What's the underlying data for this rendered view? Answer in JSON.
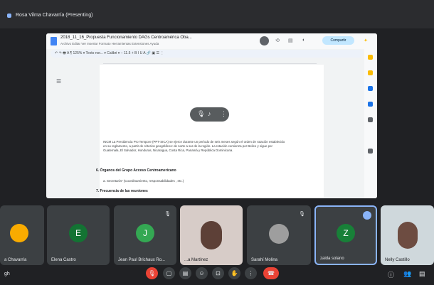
{
  "presenter": {
    "label": "Rosa Vilma Chavarría (Presenting)"
  },
  "doc": {
    "title": "2018_11_16_Propuesta Funcionamiento DAGs Centroamérica Oba...",
    "menu": "Archivo  Editar  Ver  Insertar  Formato  Herramientas  Extensiones  Ayuda",
    "share_label": "Compartir",
    "toolbar_text": "↶  ↷  🖶  A  ¶   125%  ▾   Texto nor... ▾   Calibri  ▾   −  11.5  +   B  I  U  A   🔗  ▣  ☰  ⋮",
    "paragraph": "INCM La Presidencia Pro Tempore (PPT-SICA) se ejerce durante un período de seis meses según el orden de rotación establecido en su reglamento, a partir de criterios geográficos: de norte a sur de la región. La rotación comienza por Belice y sigue por Guatemala, El Salvador, Honduras, Nicaragua, Costa Rica, Panamá y República Dominicana.",
    "heading": "6. Órganos del Grupo Acceso Centroamericano",
    "bullet": "a.  Secretaría* (Coordinamiento, responsabilidades , etc.)",
    "subheading": "7. Frecuencia de las reuniones"
  },
  "participants": [
    {
      "name": "a Chavarría",
      "initial": "",
      "color": "#1a73e8"
    },
    {
      "name": "Elena Castro",
      "initial": "E",
      "color": "#137333"
    },
    {
      "name": "Jean Paul Brichaux Ro...",
      "initial": "J",
      "color": "#34a853"
    },
    {
      "name": "...a Martínez",
      "initial": "",
      "color": "#8d6e63"
    },
    {
      "name": "Sarahí Molina",
      "initial": "",
      "color": "#5f6368"
    },
    {
      "name": "zaida solano",
      "initial": "Z",
      "color": "#188038"
    },
    {
      "name": "Nelly Castillo",
      "initial": "",
      "color": "#a1887f"
    }
  ],
  "meeting": {
    "code": "gh"
  },
  "controls": {
    "mic": "🎙",
    "camera": "▢",
    "captions": "▤",
    "emoji": "☺",
    "present": "⊡",
    "hand": "✋",
    "more": "⋮",
    "end": "☎"
  }
}
